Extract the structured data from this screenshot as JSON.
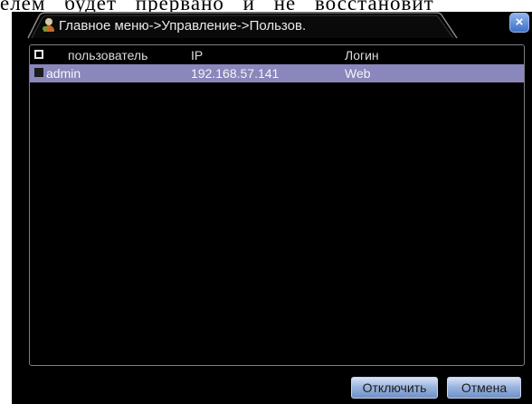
{
  "document": {
    "text_line": "елем будет прервано и не восстановит"
  },
  "dialog": {
    "title": "Главное меню->Управление->Пользов.",
    "title_icon": "user-icon",
    "close_icon": "close-icon",
    "close_label": "×"
  },
  "table": {
    "columns": [
      "пользователь",
      "IP",
      "Логин"
    ],
    "rows": [
      {
        "user": "admin",
        "ip": "192.168.57.141",
        "login": "Web",
        "selected": true
      }
    ]
  },
  "buttons": {
    "disconnect": "Отключить",
    "cancel": "Отмена"
  },
  "colors": {
    "selected_row": "#8a87bd",
    "dialog_background": "#000000",
    "button_accent": "#9db6df"
  }
}
